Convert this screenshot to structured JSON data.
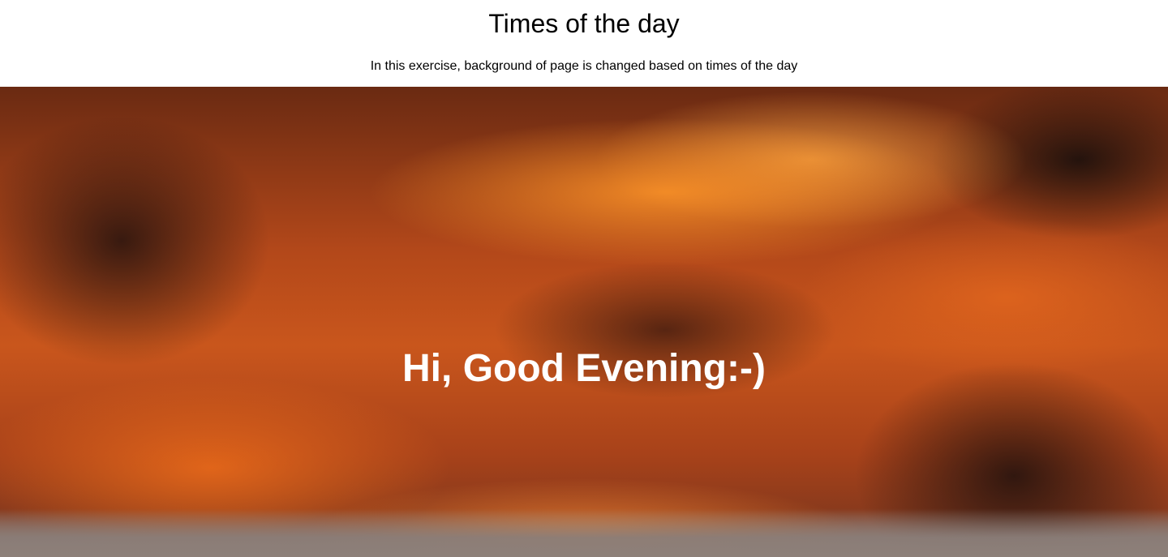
{
  "header": {
    "title": "Times of the day",
    "subtitle": "In this exercise, background of page is changed based on times of the day"
  },
  "hero": {
    "greeting": "Hi, Good Evening:-)"
  }
}
